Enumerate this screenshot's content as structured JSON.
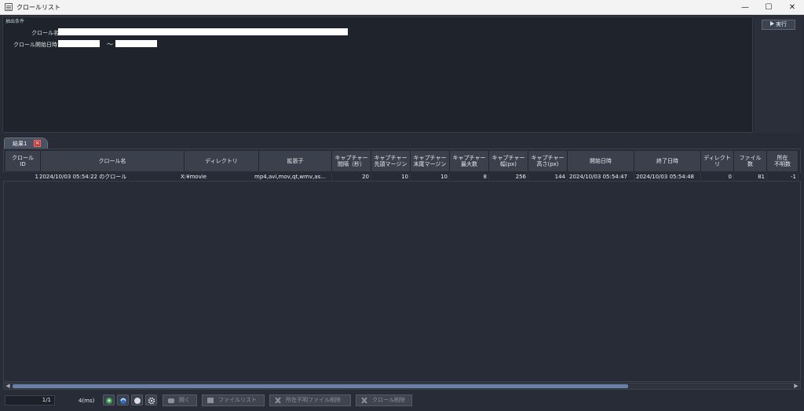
{
  "window": {
    "title": "クロールリスト",
    "minimize": "—",
    "maximize": "☐",
    "close": "✕"
  },
  "filter": {
    "legend": "抽出条件",
    "crawl_name_label": "クロール名",
    "crawl_name_value": "",
    "start_label": "クロール開始日時",
    "start_from": "",
    "tilde": "〜",
    "start_to": "",
    "run_button": "実行"
  },
  "tab": {
    "label": "結果1",
    "close": "×"
  },
  "table": {
    "columns": [
      "クロール\nID",
      "クロール名",
      "ディレクトリ",
      "拡張子",
      "キャプチャー\n間隔（秒）",
      "キャプチャー\n先頭マージン",
      "キャプチャー\n末尾マージン",
      "キャプチャー\n最大数",
      "キャプチャー\n幅(px)",
      "キャプチャー\n高さ(px)",
      "開始日時",
      "終了日時",
      "ディレクト\nリ",
      "ファイル\n数",
      "所在\n不明数"
    ],
    "rows": [
      {
        "id": "1",
        "name": "2024/10/03 05:54:22 のクロール",
        "directory": "X:¥movie",
        "extensions": "mp4,avi,mov,qt,wmv,as...",
        "interval": "20",
        "head_margin": "10",
        "tail_margin": "10",
        "max_count": "8",
        "width": "256",
        "height": "144",
        "start": "2024/10/03 05:54:47",
        "end": "2024/10/03 05:54:48",
        "dirs": "0",
        "files": "81",
        "missing": "-1"
      }
    ]
  },
  "status": {
    "page": "1/1",
    "elapsed": "4(ms)",
    "open_button": "開く",
    "filelist_button": "ファイルリスト",
    "delete_missing_button": "所在不明ファイル削除",
    "delete_crawl_button": "クロール削除"
  },
  "colors": {
    "background": "#272c36",
    "panel": "#1e232c",
    "header": "#3a404c",
    "scroll_thumb": "#6a7fa6",
    "tab_close": "#c43a3a"
  },
  "icons": [
    "refresh-icon",
    "sync-icon",
    "stop-icon",
    "settings-icon"
  ]
}
